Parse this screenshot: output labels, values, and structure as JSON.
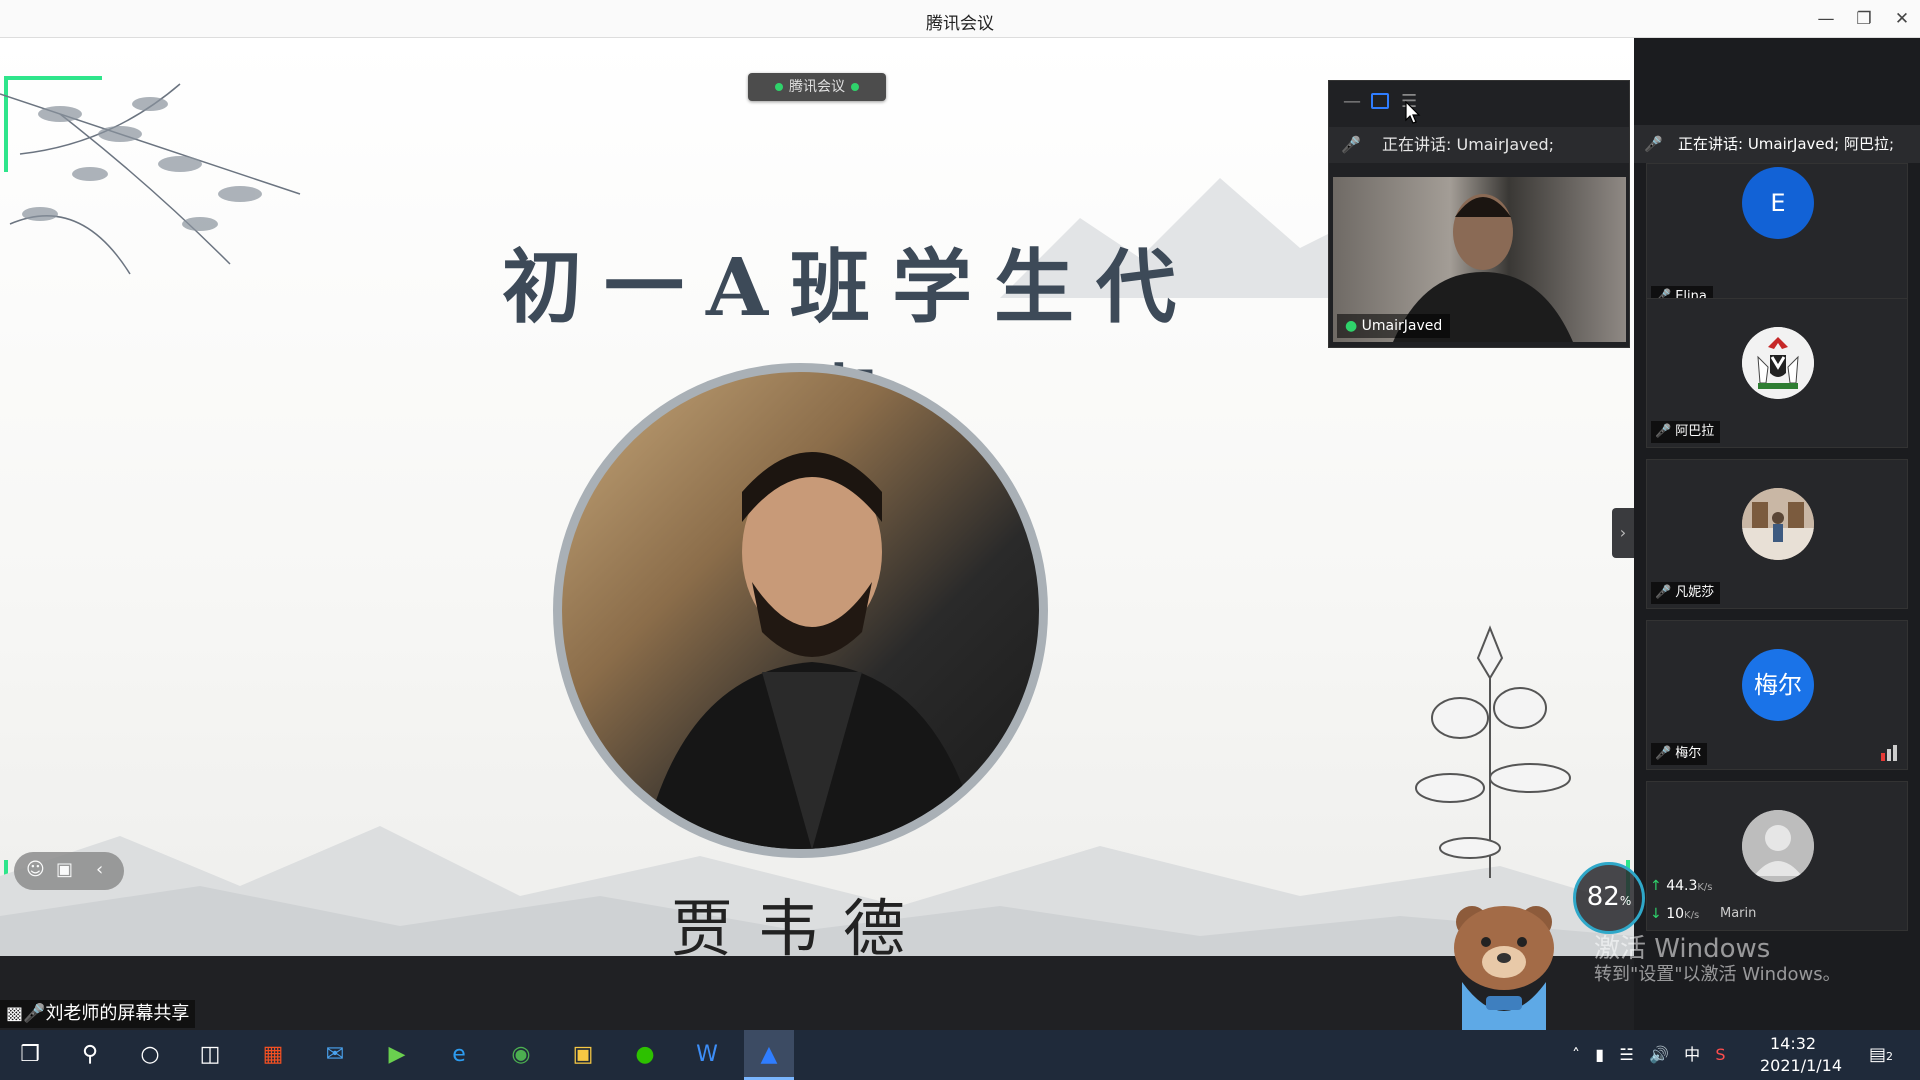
{
  "window": {
    "title": "腾讯会议",
    "min_icon": "minimize-icon",
    "restore_icon": "restore-icon",
    "close_icon": "close-icon"
  },
  "slide": {
    "title": "初一A班学生代表",
    "student_name": "贾韦德",
    "meeting_tag": "腾讯会议"
  },
  "floating_window": {
    "speaking": "正在讲话: UmairJaved;",
    "video_name": "UmairJaved"
  },
  "panel": {
    "speaking": "正在讲话: UmairJaved; 阿巴拉;",
    "participants": [
      {
        "name": "Elina",
        "avatar_text": "E",
        "avatar_color": "#1262d6",
        "mic": "muted"
      },
      {
        "name": "阿巴拉",
        "avatar_text": "",
        "avatar_color": "#f2f2f2",
        "mic": "on"
      },
      {
        "name": "凡妮莎",
        "avatar_text": "",
        "avatar_color": "#c9b7a5",
        "mic": "muted"
      },
      {
        "name": "梅尔",
        "avatar_text": "梅尔",
        "avatar_color": "#1a73e8",
        "mic": "muted"
      },
      {
        "name": "Marin",
        "avatar_text": "",
        "avatar_color": "#bdbdbd",
        "mic": "muted"
      }
    ]
  },
  "net_speed": {
    "percent": "82",
    "percent_unit": "%",
    "upload": "44.3",
    "upload_unit": "K/s",
    "download": "10",
    "download_unit": "K/s"
  },
  "activation": {
    "title": "激活 Windows",
    "subtitle": "转到\"设置\"以激活 Windows。"
  },
  "share_bar": {
    "label": "刘老师的屏幕共享"
  },
  "taskbar": {
    "ime": "中",
    "time": "14:32",
    "date": "2021/1/14",
    "notification_count": "2"
  }
}
